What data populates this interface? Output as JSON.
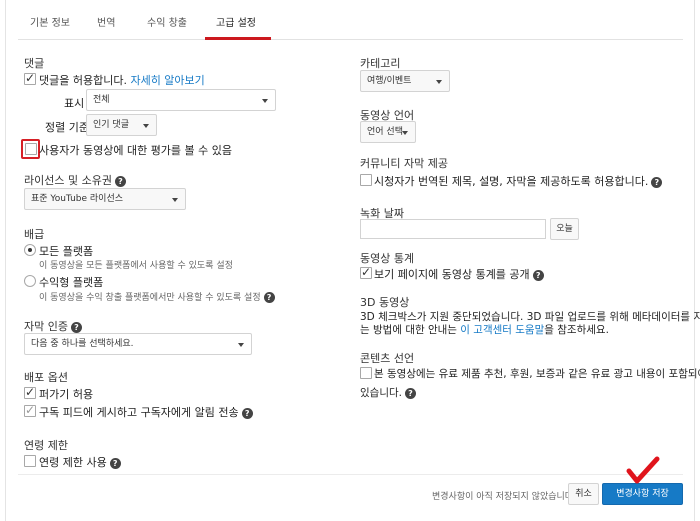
{
  "tabs": [
    {
      "label": "기본 정보"
    },
    {
      "label": "번역"
    },
    {
      "label": "수익 창출"
    },
    {
      "label": "고급 설정"
    }
  ],
  "comments": {
    "title": "댓글",
    "allow_label": "댓글을 허용합니다.",
    "learn_more": "자세히 알아보기",
    "display_label": "표시",
    "display_value": "전체",
    "sort_label": "정렬 기준",
    "sort_value": "인기 댓글",
    "ratings_label": "사용자가 동영상에 대한 평가를 볼 수 있음"
  },
  "license": {
    "title": "라이선스 및 소유권",
    "value": "표준 YouTube 라이선스"
  },
  "distribution": {
    "title": "배급",
    "all_platforms": "모든 플랫폼",
    "all_platforms_desc": "이 동영상을 모든 플랫폼에서 사용할 수 있도록 설정",
    "monetized_platforms": "수익형 플랫폼",
    "monetized_platforms_desc": "이 동영상을 수익 창출 플랫폼에서만 사용할 수 있도록 설정"
  },
  "caption_cert": {
    "title": "자막 인증",
    "value": "다음 중 하나를 선택하세요."
  },
  "distribution_options": {
    "title": "배포 옵션",
    "embed_label": "퍼가기 허용",
    "notify_label": "구독 피드에 게시하고 구독자에게 알림 전송"
  },
  "age": {
    "title": "연령 제한",
    "label": "연령 제한 사용"
  },
  "category": {
    "title": "카테고리",
    "value": "여행/이벤트"
  },
  "video_language": {
    "title": "동영상 언어",
    "value": "언어 선택"
  },
  "community": {
    "title": "커뮤니티 자막 제공",
    "label": "시청자가 번역된 제목, 설명, 자막을 제공하도록 허용합니다."
  },
  "recording": {
    "title": "녹화 날짜",
    "today_button": "오늘"
  },
  "stats": {
    "title": "동영상 통계",
    "label": "보기 페이지에 동영상 통계를 공개"
  },
  "three_d": {
    "title": "3D 동영상",
    "line1": "3D 체크박스가 지원 중단되었습니다. 3D 파일 업로드를 위해 메타데이터를 지정하",
    "line2_pre": "는 방법에 대한 안내는 ",
    "line2_link": "이 고객센터 도움말",
    "line2_post": "을 참조하세요."
  },
  "content": {
    "title": "콘텐츠 선언",
    "line1": "본 동영상에는 유료 제품 추천, 후원, 보증과 같은 유료 광고 내용이 포함되어",
    "line2": "있습니다."
  },
  "footer": {
    "unsaved": "변경사항이 아직 저장되지 않았습니다.",
    "cancel": "취소",
    "save": "변경사항 저장"
  },
  "icons": {
    "help": "?",
    "check": "✓"
  },
  "colors": {
    "accent": "#167ac6",
    "highlight": "#d61f26",
    "checkmark_annotation": "#e0141c"
  }
}
